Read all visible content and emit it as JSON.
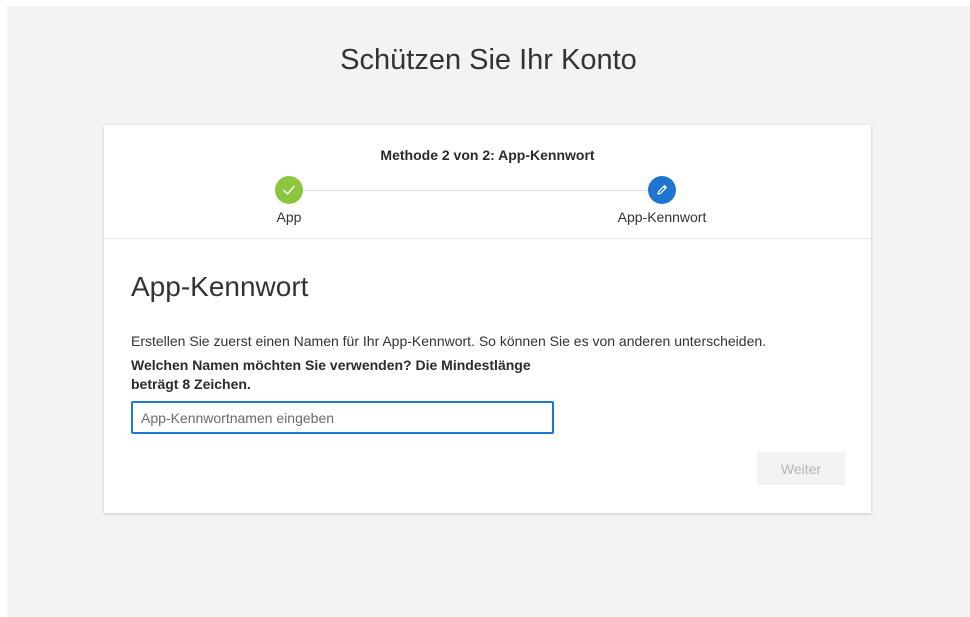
{
  "page": {
    "title": "Schützen Sie Ihr Konto"
  },
  "wizard": {
    "step_heading": "Methode 2 von 2: App-Kennwort",
    "steps": [
      {
        "label": "App",
        "state": "done",
        "icon": "checkmark-icon"
      },
      {
        "label": "App-Kennwort",
        "state": "current",
        "icon": "pencil-icon"
      }
    ]
  },
  "form": {
    "title": "App-Kennwort",
    "instructions": "Erstellen Sie zuerst einen Namen für Ihr App-Kennwort. So können Sie es von anderen unterscheiden.",
    "question": "Welchen Namen möchten Sie verwenden? Die Mindestlänge beträgt 8 Zeichen.",
    "name_input": {
      "value": "",
      "placeholder": "App-Kennwortnamen eingeben"
    },
    "next_label": "Weiter"
  },
  "colors": {
    "done": "#8cc63f",
    "current": "#1f75d2",
    "background": "#f3f3f3"
  }
}
